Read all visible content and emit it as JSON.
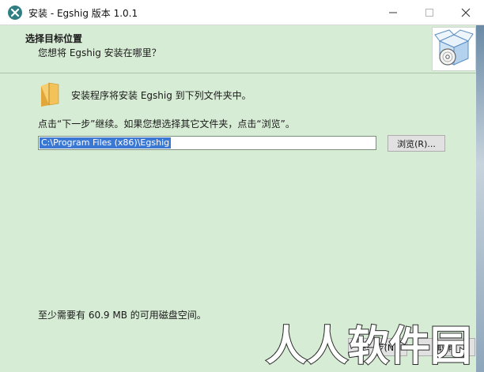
{
  "window": {
    "title": "安装 - Egshig 版本 1.0.1"
  },
  "header": {
    "title": "选择目标位置",
    "subtitle": "您想将 Egshig 安装在哪里？"
  },
  "body": {
    "install_message": "安装程序将安装 Egshig 到下列文件夹中。",
    "continue_message": "点击“下一步”继续。如果您想选择其它文件夹，点击“浏览”。",
    "path_value": "C:\\Program Files (x86)\\Egshig",
    "browse_label": "浏览(R)...",
    "space_message": "至少需要有 60.9 MB 的可用磁盘空间。"
  },
  "footer": {
    "next_label": "下一步(N)",
    "cancel_label": "取消"
  },
  "watermark": {
    "text": "人人软件园"
  },
  "colors": {
    "background": "#d7ecd5",
    "selection": "#3a78d4",
    "app_icon": "#2f7f82"
  },
  "icons": {
    "app": "x-logo-icon",
    "folder": "folder-icon",
    "installer": "box-disc-icon"
  }
}
